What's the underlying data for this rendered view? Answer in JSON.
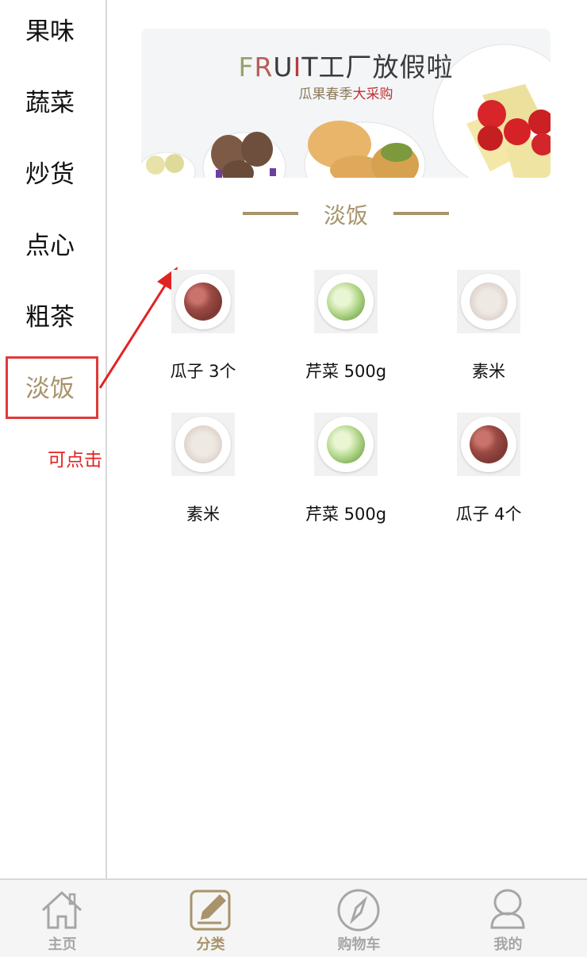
{
  "sidebar": {
    "items": [
      {
        "label": "果味",
        "active": false
      },
      {
        "label": "蔬菜",
        "active": false
      },
      {
        "label": "炒货",
        "active": false
      },
      {
        "label": "点心",
        "active": false
      },
      {
        "label": "粗茶",
        "active": false
      },
      {
        "label": "淡饭",
        "active": true
      }
    ]
  },
  "annotation": {
    "text": "可点击",
    "color": "#e32222"
  },
  "banner": {
    "title_letters": [
      "F",
      "R",
      "U",
      "I",
      "T"
    ],
    "title_rest": "工厂放假啦",
    "subtitle_prefix": "瓜果春季",
    "subtitle_emphasis": "大采购"
  },
  "section": {
    "title": "淡饭"
  },
  "products": [
    {
      "name": "瓜子 3个",
      "image": "sunflower-seeds"
    },
    {
      "name": "芹菜 500g",
      "image": "celery"
    },
    {
      "name": "素米",
      "image": "rice"
    },
    {
      "name": "素米",
      "image": "rice"
    },
    {
      "name": "芹菜 500g",
      "image": "celery"
    },
    {
      "name": "瓜子 4个",
      "image": "sunflower-seeds"
    }
  ],
  "tabbar": {
    "tabs": [
      {
        "label": "主页",
        "icon": "home-icon",
        "active": false
      },
      {
        "label": "分类",
        "icon": "edit-icon",
        "active": true
      },
      {
        "label": "购物车",
        "icon": "compass-icon",
        "active": false
      },
      {
        "label": "我的",
        "icon": "user-icon",
        "active": false
      }
    ]
  },
  "colors": {
    "accent": "#a8936b",
    "annotation": "#e03a3a",
    "inactive": "#a6a6a6"
  }
}
